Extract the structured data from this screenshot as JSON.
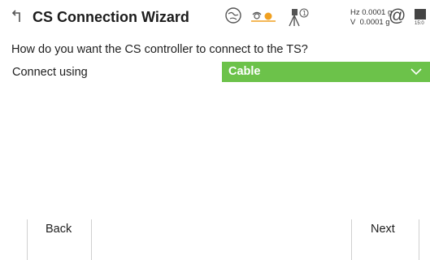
{
  "header": {
    "title": "CS Connection Wizard",
    "readout_hz": "Hz 0.0001 g",
    "readout_v": "V  0.0001 g",
    "at_symbol": "@",
    "battery_label": "15:0",
    "icons": [
      "back-arrow-icon",
      "globe-icon",
      "prism-target-icon",
      "tripod-1-icon",
      "battery-icon"
    ]
  },
  "main": {
    "question": "How do you want the CS controller to connect to the TS?",
    "connect_label": "Connect using",
    "connect_value": "Cable"
  },
  "footer": {
    "back_label": "Back",
    "next_label": "Next"
  },
  "colors": {
    "dropdown_bg": "#6cc24a",
    "prism_orange": "#f0a020"
  }
}
